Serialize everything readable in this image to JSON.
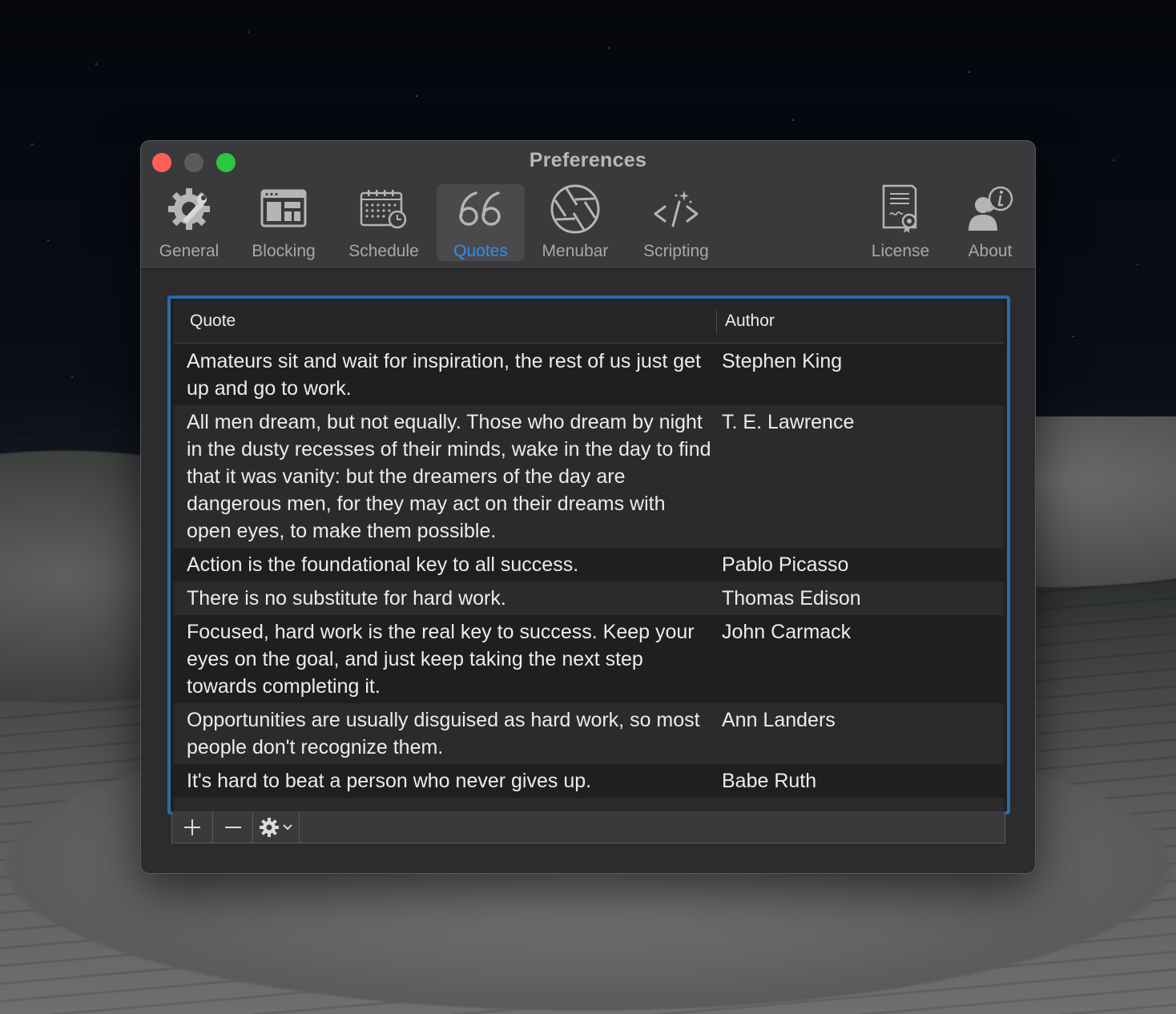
{
  "window": {
    "title": "Preferences"
  },
  "toolbar": {
    "tabs": [
      {
        "label": "General",
        "icon": "gear-wrench-icon"
      },
      {
        "label": "Blocking",
        "icon": "blocking-window-icon"
      },
      {
        "label": "Schedule",
        "icon": "calendar-clock-icon"
      },
      {
        "label": "Quotes",
        "icon": "quote-icon",
        "active": true
      },
      {
        "label": "Menubar",
        "icon": "aperture-icon"
      },
      {
        "label": "Scripting",
        "icon": "code-icon"
      },
      {
        "label": "License",
        "icon": "certificate-icon"
      },
      {
        "label": "About",
        "icon": "user-info-icon"
      }
    ],
    "active_color": "#2f8df5"
  },
  "table": {
    "columns": {
      "quote": "Quote",
      "author": "Author"
    },
    "rows": [
      {
        "quote": "Amateurs sit and wait for inspiration, the rest of us just get up and go to work.",
        "author": "Stephen King"
      },
      {
        "quote": "All men dream, but not equally. Those who dream by night in the dusty recesses of their minds, wake in the day to find that it was vanity: but the dreamers of the day are dangerous men, for they may act on their dreams with open eyes, to make them possible.",
        "author": "T. E. Lawrence"
      },
      {
        "quote": "Action is the foundational key to all success.",
        "author": "Pablo Picasso"
      },
      {
        "quote": "There is no substitute for hard work.",
        "author": "Thomas Edison"
      },
      {
        "quote": "Focused, hard work is the real key to success. Keep your eyes on the goal, and just keep taking the next step towards completing it.",
        "author": "John Carmack"
      },
      {
        "quote": "Opportunities are usually disguised as hard work, so most people don't recognize them.",
        "author": "Ann Landers"
      },
      {
        "quote": "It's hard to beat a person who never gives up.",
        "author": "Babe Ruth"
      }
    ],
    "focus_color": "#2b6aa5"
  },
  "bottom_bar": {
    "add_icon": "plus-icon",
    "remove_icon": "minus-icon",
    "action_icon": "gear-dropdown-icon"
  }
}
